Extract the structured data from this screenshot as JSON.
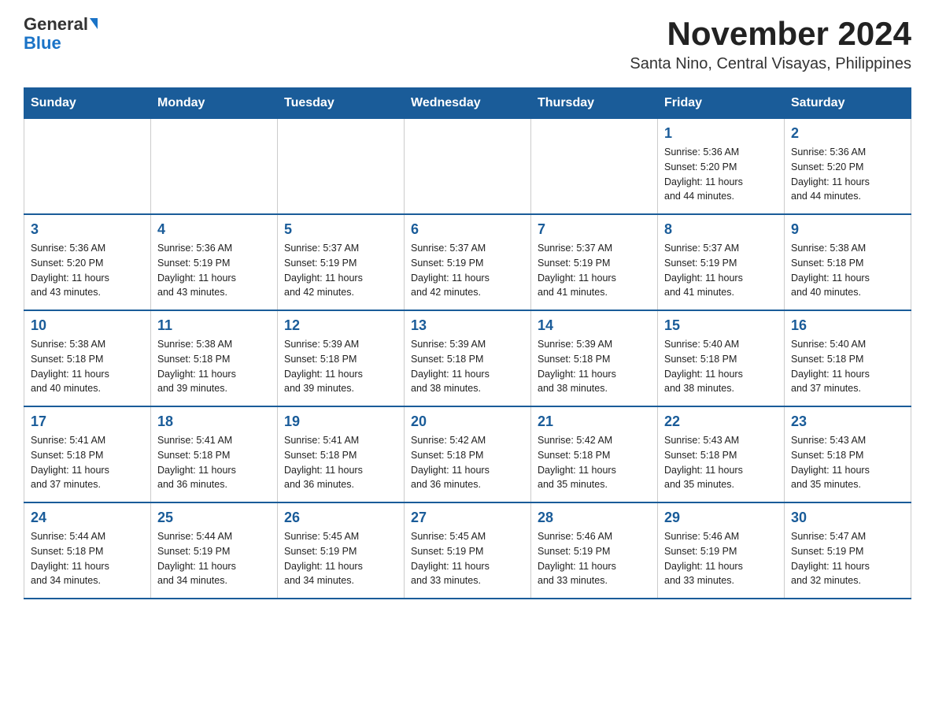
{
  "header": {
    "logo_general": "General",
    "logo_blue": "Blue",
    "title": "November 2024",
    "subtitle": "Santa Nino, Central Visayas, Philippines"
  },
  "calendar": {
    "days_of_week": [
      "Sunday",
      "Monday",
      "Tuesday",
      "Wednesday",
      "Thursday",
      "Friday",
      "Saturday"
    ],
    "weeks": [
      [
        {
          "day": "",
          "info": ""
        },
        {
          "day": "",
          "info": ""
        },
        {
          "day": "",
          "info": ""
        },
        {
          "day": "",
          "info": ""
        },
        {
          "day": "",
          "info": ""
        },
        {
          "day": "1",
          "info": "Sunrise: 5:36 AM\nSunset: 5:20 PM\nDaylight: 11 hours\nand 44 minutes."
        },
        {
          "day": "2",
          "info": "Sunrise: 5:36 AM\nSunset: 5:20 PM\nDaylight: 11 hours\nand 44 minutes."
        }
      ],
      [
        {
          "day": "3",
          "info": "Sunrise: 5:36 AM\nSunset: 5:20 PM\nDaylight: 11 hours\nand 43 minutes."
        },
        {
          "day": "4",
          "info": "Sunrise: 5:36 AM\nSunset: 5:19 PM\nDaylight: 11 hours\nand 43 minutes."
        },
        {
          "day": "5",
          "info": "Sunrise: 5:37 AM\nSunset: 5:19 PM\nDaylight: 11 hours\nand 42 minutes."
        },
        {
          "day": "6",
          "info": "Sunrise: 5:37 AM\nSunset: 5:19 PM\nDaylight: 11 hours\nand 42 minutes."
        },
        {
          "day": "7",
          "info": "Sunrise: 5:37 AM\nSunset: 5:19 PM\nDaylight: 11 hours\nand 41 minutes."
        },
        {
          "day": "8",
          "info": "Sunrise: 5:37 AM\nSunset: 5:19 PM\nDaylight: 11 hours\nand 41 minutes."
        },
        {
          "day": "9",
          "info": "Sunrise: 5:38 AM\nSunset: 5:18 PM\nDaylight: 11 hours\nand 40 minutes."
        }
      ],
      [
        {
          "day": "10",
          "info": "Sunrise: 5:38 AM\nSunset: 5:18 PM\nDaylight: 11 hours\nand 40 minutes."
        },
        {
          "day": "11",
          "info": "Sunrise: 5:38 AM\nSunset: 5:18 PM\nDaylight: 11 hours\nand 39 minutes."
        },
        {
          "day": "12",
          "info": "Sunrise: 5:39 AM\nSunset: 5:18 PM\nDaylight: 11 hours\nand 39 minutes."
        },
        {
          "day": "13",
          "info": "Sunrise: 5:39 AM\nSunset: 5:18 PM\nDaylight: 11 hours\nand 38 minutes."
        },
        {
          "day": "14",
          "info": "Sunrise: 5:39 AM\nSunset: 5:18 PM\nDaylight: 11 hours\nand 38 minutes."
        },
        {
          "day": "15",
          "info": "Sunrise: 5:40 AM\nSunset: 5:18 PM\nDaylight: 11 hours\nand 38 minutes."
        },
        {
          "day": "16",
          "info": "Sunrise: 5:40 AM\nSunset: 5:18 PM\nDaylight: 11 hours\nand 37 minutes."
        }
      ],
      [
        {
          "day": "17",
          "info": "Sunrise: 5:41 AM\nSunset: 5:18 PM\nDaylight: 11 hours\nand 37 minutes."
        },
        {
          "day": "18",
          "info": "Sunrise: 5:41 AM\nSunset: 5:18 PM\nDaylight: 11 hours\nand 36 minutes."
        },
        {
          "day": "19",
          "info": "Sunrise: 5:41 AM\nSunset: 5:18 PM\nDaylight: 11 hours\nand 36 minutes."
        },
        {
          "day": "20",
          "info": "Sunrise: 5:42 AM\nSunset: 5:18 PM\nDaylight: 11 hours\nand 36 minutes."
        },
        {
          "day": "21",
          "info": "Sunrise: 5:42 AM\nSunset: 5:18 PM\nDaylight: 11 hours\nand 35 minutes."
        },
        {
          "day": "22",
          "info": "Sunrise: 5:43 AM\nSunset: 5:18 PM\nDaylight: 11 hours\nand 35 minutes."
        },
        {
          "day": "23",
          "info": "Sunrise: 5:43 AM\nSunset: 5:18 PM\nDaylight: 11 hours\nand 35 minutes."
        }
      ],
      [
        {
          "day": "24",
          "info": "Sunrise: 5:44 AM\nSunset: 5:18 PM\nDaylight: 11 hours\nand 34 minutes."
        },
        {
          "day": "25",
          "info": "Sunrise: 5:44 AM\nSunset: 5:19 PM\nDaylight: 11 hours\nand 34 minutes."
        },
        {
          "day": "26",
          "info": "Sunrise: 5:45 AM\nSunset: 5:19 PM\nDaylight: 11 hours\nand 34 minutes."
        },
        {
          "day": "27",
          "info": "Sunrise: 5:45 AM\nSunset: 5:19 PM\nDaylight: 11 hours\nand 33 minutes."
        },
        {
          "day": "28",
          "info": "Sunrise: 5:46 AM\nSunset: 5:19 PM\nDaylight: 11 hours\nand 33 minutes."
        },
        {
          "day": "29",
          "info": "Sunrise: 5:46 AM\nSunset: 5:19 PM\nDaylight: 11 hours\nand 33 minutes."
        },
        {
          "day": "30",
          "info": "Sunrise: 5:47 AM\nSunset: 5:19 PM\nDaylight: 11 hours\nand 32 minutes."
        }
      ]
    ]
  }
}
